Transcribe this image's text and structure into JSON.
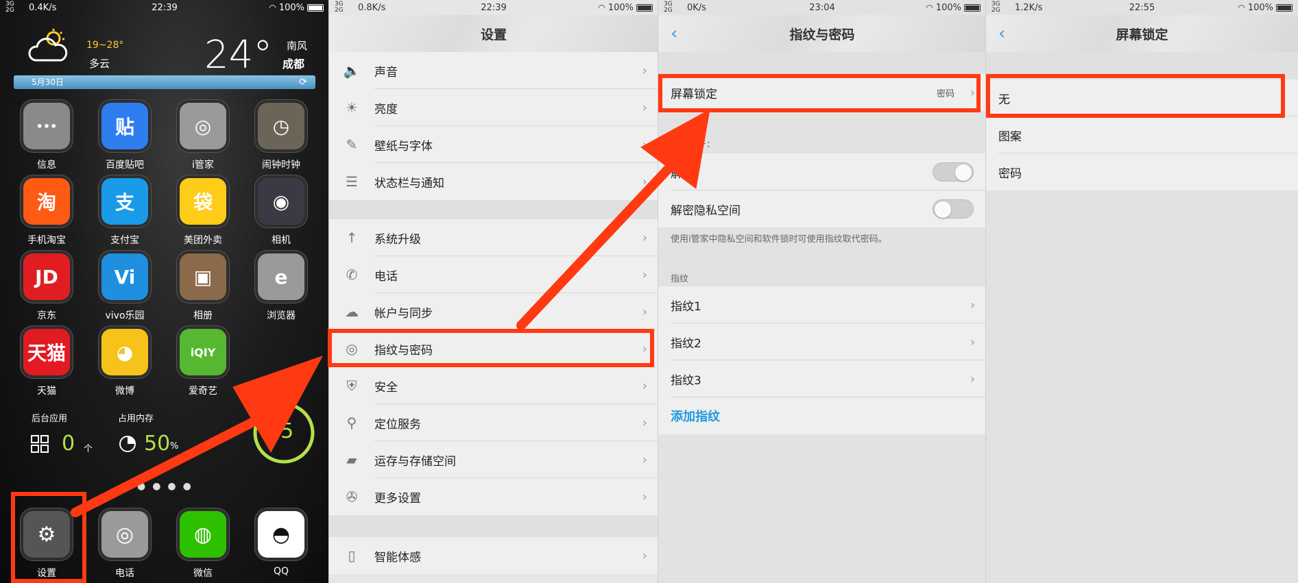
{
  "colors": {
    "accent": "#ff3a12",
    "link": "#1e9ae0",
    "widget_green": "#b4e04a"
  },
  "home": {
    "status": {
      "signal": "3G G ıll\n2G",
      "net": "0.4K/s",
      "time": "22:39",
      "battery": "100%"
    },
    "weather": {
      "temp_range": "19~28°",
      "desc": "多云",
      "temp": "24°",
      "wind": "南风",
      "city": "成都",
      "date": "5月30日"
    },
    "apps": [
      {
        "label": "信息",
        "icon": "message-icon",
        "glyph": "•••",
        "color": "#8a8a8a"
      },
      {
        "label": "百度贴吧",
        "icon": "tieba-icon",
        "glyph": "贴",
        "color": "#2f7ef0"
      },
      {
        "label": "i管家",
        "icon": "iguanjia-icon",
        "glyph": "◎",
        "color": "#9a9a9a"
      },
      {
        "label": "闹钟时钟",
        "icon": "clock-icon",
        "glyph": "◷",
        "color": "#6b6558"
      },
      {
        "label": "手机淘宝",
        "icon": "taobao-icon",
        "glyph": "淘",
        "color": "#ff5a14"
      },
      {
        "label": "支付宝",
        "icon": "alipay-icon",
        "glyph": "支",
        "color": "#1a9be8"
      },
      {
        "label": "美团外卖",
        "icon": "meituan-icon",
        "glyph": "袋",
        "color": "#ffcc1a"
      },
      {
        "label": "相机",
        "icon": "camera-icon",
        "glyph": "◉",
        "color": "#3a3a44"
      },
      {
        "label": "京东",
        "icon": "jd-icon",
        "glyph": "JD",
        "color": "#e01e22"
      },
      {
        "label": "vivo乐园",
        "icon": "vivo-park-icon",
        "glyph": "Vi",
        "color": "#1f8fe0"
      },
      {
        "label": "相册",
        "icon": "gallery-icon",
        "glyph": "▣",
        "color": "#8a6a4a"
      },
      {
        "label": "浏览器",
        "icon": "browser-icon",
        "glyph": "e",
        "color": "#9a9a9a"
      },
      {
        "label": "天猫",
        "icon": "tmall-icon",
        "glyph": "天猫",
        "color": "#e21b22"
      },
      {
        "label": "微博",
        "icon": "weibo-icon",
        "glyph": "◕",
        "color": "#f5c319"
      },
      {
        "label": "爱奇艺",
        "icon": "iqiyi-icon",
        "glyph": "iQIY",
        "color": "#55b830"
      }
    ],
    "widget": {
      "bg_apps_label": "后台应用",
      "bg_apps_value": "0",
      "bg_apps_unit": "个",
      "mem_label": "占用内存",
      "mem_value": "50",
      "mem_unit": "%",
      "score": "95"
    },
    "dock": [
      {
        "label": "设置",
        "icon": "settings-gear-icon",
        "glyph": "⚙",
        "color": "#555555"
      },
      {
        "label": "电话",
        "icon": "phone-dial-icon",
        "glyph": "◎",
        "color": "#9a9a9a"
      },
      {
        "label": "微信",
        "icon": "wechat-icon",
        "glyph": "◍",
        "color": "#2dc100"
      },
      {
        "label": "QQ",
        "icon": "qq-icon",
        "glyph": "◓",
        "color": "#ffffff"
      }
    ]
  },
  "settings": {
    "status": {
      "signal": "3G G ıll\n2G",
      "net": "0.8K/s",
      "time": "22:39",
      "battery": "100%"
    },
    "title": "设置",
    "group1": [
      {
        "label": "声音",
        "icon": "speaker-icon",
        "glyph": "🔈"
      },
      {
        "label": "亮度",
        "icon": "brightness-icon",
        "glyph": "☀"
      },
      {
        "label": "壁纸与字体",
        "icon": "brush-icon",
        "glyph": "✎"
      },
      {
        "label": "状态栏与通知",
        "icon": "list-icon",
        "glyph": "☰"
      }
    ],
    "group2": [
      {
        "label": "系统升级",
        "icon": "arrow-up-icon",
        "glyph": "↑"
      },
      {
        "label": "电话",
        "icon": "phone-icon",
        "glyph": "✆"
      },
      {
        "label": "帐户与同步",
        "icon": "cloud-sync-icon",
        "glyph": "☁"
      },
      {
        "label": "指纹与密码",
        "icon": "fingerprint-icon",
        "glyph": "◎"
      },
      {
        "label": "安全",
        "icon": "shield-icon",
        "glyph": "⛨"
      },
      {
        "label": "定位服务",
        "icon": "location-pin-icon",
        "glyph": "⚲"
      },
      {
        "label": "运存与存储空间",
        "icon": "sd-card-icon",
        "glyph": "▰"
      },
      {
        "label": "更多设置",
        "icon": "wrench-icon",
        "glyph": "✇"
      }
    ],
    "group3": [
      {
        "label": "智能体感",
        "icon": "motion-phone-icon",
        "glyph": "▯"
      }
    ]
  },
  "fingerprint": {
    "status": {
      "signal": "3G G ıll\n2G",
      "net": "0K/s",
      "time": "23:04",
      "battery": "100%"
    },
    "title": "指纹与密码",
    "screen_lock_label": "屏幕锁定",
    "screen_lock_value": "密码",
    "use_for_header": "指纹用于：",
    "unlock_label": "解锁",
    "private_label": "解密隐私空间",
    "hint": "使用i管家中隐私空间和软件锁时可使用指纹取代密码。",
    "fp_header": "指纹",
    "fingerprints": [
      "指纹1",
      "指纹2",
      "指纹3"
    ],
    "add_label": "添加指纹"
  },
  "screenlock": {
    "status": {
      "signal": "3G G ıll\n2G",
      "net": "1.2K/s",
      "time": "22:55",
      "battery": "100%"
    },
    "title": "屏幕锁定",
    "options": [
      "无",
      "图案",
      "密码"
    ]
  }
}
